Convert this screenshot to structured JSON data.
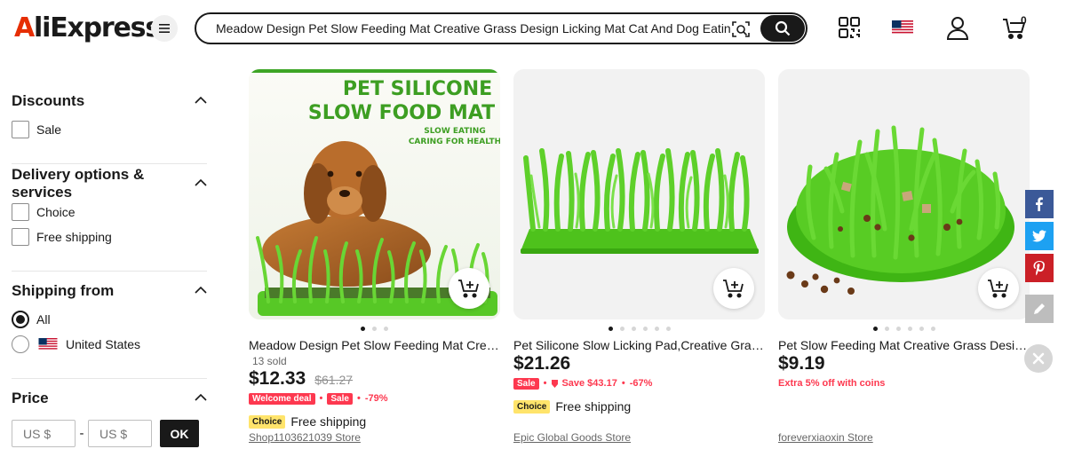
{
  "header": {
    "logo": "AliExpress",
    "search": {
      "value": "Meadow Design Pet Slow Feeding Mat Creative Grass Design Licking Mat Cat And Dog Eating Lick"
    },
    "cart_count": "0",
    "icons": [
      "menu-icon",
      "camera-search-icon",
      "search-icon",
      "qr-code-icon",
      "us-flag-icon",
      "user-icon",
      "cart-icon"
    ]
  },
  "filters": {
    "discounts": {
      "title": "Discounts",
      "options": [
        "Sale"
      ]
    },
    "delivery": {
      "title": "Delivery options & services",
      "options": [
        "Choice",
        "Free shipping"
      ]
    },
    "shipping_from": {
      "title": "Shipping from",
      "options": [
        "All",
        "United States"
      ],
      "selected": "All"
    },
    "price": {
      "title": "Price",
      "min_placeholder": "US $",
      "max_placeholder": "US $",
      "dash": "-",
      "ok": "OK"
    }
  },
  "products": [
    {
      "image_text": {
        "line1": "PET SILICONE",
        "line2": "SLOW FOOD MAT",
        "line3": "SLOW EATING",
        "line4": "CARING FOR HEALTH"
      },
      "title": "Meadow Design Pet Slow Feeding Mat Creative Grass Design Licking Mat Cat And Dog",
      "sold": "13 sold",
      "price": "$12.33",
      "original_price": "$61.27",
      "tag1": "Welcome deal",
      "tag2": "Sale",
      "discount": "-79%",
      "choice": "Choice",
      "shipping": "Free shipping",
      "store": "Shop1103621039 Store",
      "dots": 3,
      "active_dot": 0
    },
    {
      "title": "Pet Silicone Slow Licking Pad,Creative Grass Design Cat And Dog Feeding Mat",
      "price": "$21.26",
      "tag1": "Sale",
      "save": "Save $43.17",
      "discount": "-67%",
      "choice": "Choice",
      "shipping": "Free shipping",
      "store": "Epic Global Goods Store",
      "dots": 6,
      "active_dot": 0
    },
    {
      "title": "Pet Slow Feeding Mat Creative Grass Design Lick Pad For Cats And Dogs",
      "price": "$9.19",
      "coins": "Extra 5% off with coins",
      "store": "foreverxiaoxin Store",
      "dots": 6,
      "active_dot": 0
    }
  ],
  "share": [
    "facebook-icon",
    "twitter-icon",
    "pinterest-icon",
    "edit-icon",
    "close-icon"
  ],
  "colors": {
    "accent_red": "#fd384f",
    "logo_red": "#e62e04",
    "choice_yellow": "#ffe46b",
    "facebook": "#3b5998",
    "twitter": "#1da1f2",
    "pinterest": "#cb2027",
    "edit": "#bdbdbd",
    "grass_green": "#5fd62a"
  }
}
